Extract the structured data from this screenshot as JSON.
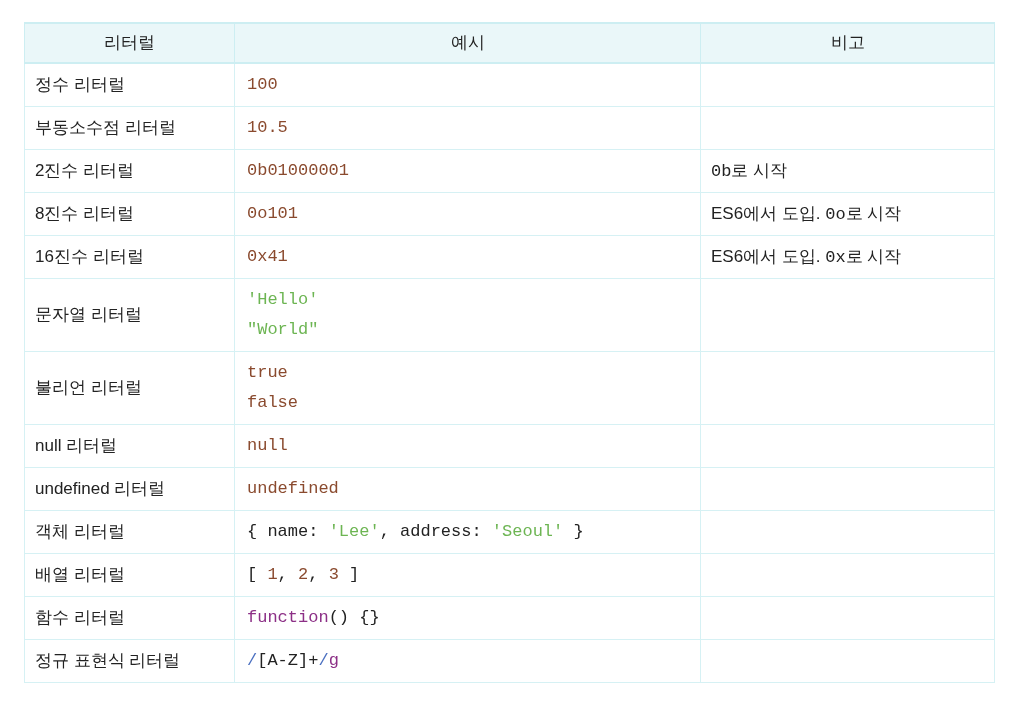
{
  "table": {
    "columns": [
      "리터럴",
      "예시",
      "비고"
    ],
    "rows": [
      {
        "literal": "정수 리터럴",
        "example": [
          [
            {
              "kind": "number",
              "text": "100"
            }
          ]
        ],
        "note": []
      },
      {
        "literal": "부동소수점 리터럴",
        "example": [
          [
            {
              "kind": "number",
              "text": "10.5"
            }
          ]
        ],
        "note": []
      },
      {
        "literal": "2진수 리터럴",
        "example": [
          [
            {
              "kind": "number",
              "text": "0b01000001"
            }
          ]
        ],
        "note": [
          {
            "kind": "code",
            "text": "0b"
          },
          {
            "kind": "text",
            "text": "로 시작"
          }
        ]
      },
      {
        "literal": "8진수 리터럴",
        "example": [
          [
            {
              "kind": "number",
              "text": "0o101"
            }
          ]
        ],
        "note": [
          {
            "kind": "text",
            "text": "ES6에서 도입. "
          },
          {
            "kind": "code",
            "text": "0o"
          },
          {
            "kind": "text",
            "text": "로 시작"
          }
        ]
      },
      {
        "literal": "16진수 리터럴",
        "example": [
          [
            {
              "kind": "number",
              "text": "0x41"
            }
          ]
        ],
        "note": [
          {
            "kind": "text",
            "text": "ES6에서 도입. "
          },
          {
            "kind": "code",
            "text": "0x"
          },
          {
            "kind": "text",
            "text": "로 시작"
          }
        ]
      },
      {
        "literal": "문자열 리터럴",
        "example": [
          [
            {
              "kind": "string",
              "text": "'Hello'"
            }
          ],
          [
            {
              "kind": "string",
              "text": "\"World\""
            }
          ]
        ],
        "note": []
      },
      {
        "literal": "불리언 리터럴",
        "example": [
          [
            {
              "kind": "number",
              "text": "true"
            }
          ],
          [
            {
              "kind": "number",
              "text": "false"
            }
          ]
        ],
        "note": []
      },
      {
        "literal": "null 리터럴",
        "example": [
          [
            {
              "kind": "number",
              "text": "null"
            }
          ]
        ],
        "note": []
      },
      {
        "literal": "undefined 리터럴",
        "example": [
          [
            {
              "kind": "number",
              "text": "undefined"
            }
          ]
        ],
        "note": []
      },
      {
        "literal": "객체 리터럴",
        "example": [
          [
            {
              "kind": "plain",
              "text": "{ name: "
            },
            {
              "kind": "string",
              "text": "'Lee'"
            },
            {
              "kind": "plain",
              "text": ", address: "
            },
            {
              "kind": "string",
              "text": "'Seoul'"
            },
            {
              "kind": "plain",
              "text": " }"
            }
          ]
        ],
        "note": []
      },
      {
        "literal": "배열 리터럴",
        "example": [
          [
            {
              "kind": "plain",
              "text": "[ "
            },
            {
              "kind": "number",
              "text": "1"
            },
            {
              "kind": "plain",
              "text": ", "
            },
            {
              "kind": "number",
              "text": "2"
            },
            {
              "kind": "plain",
              "text": ", "
            },
            {
              "kind": "number",
              "text": "3"
            },
            {
              "kind": "plain",
              "text": " ]"
            }
          ]
        ],
        "note": []
      },
      {
        "literal": "함수 리터럴",
        "example": [
          [
            {
              "kind": "keyword",
              "text": "function"
            },
            {
              "kind": "plain",
              "text": "() {}"
            }
          ]
        ],
        "note": []
      },
      {
        "literal": "정규 표현식 리터럴",
        "example": [
          [
            {
              "kind": "regex",
              "text": "/"
            },
            {
              "kind": "plain",
              "text": "[A-Z]+"
            },
            {
              "kind": "regex",
              "text": "/"
            },
            {
              "kind": "keyword",
              "text": "g"
            }
          ]
        ],
        "note": []
      }
    ]
  }
}
